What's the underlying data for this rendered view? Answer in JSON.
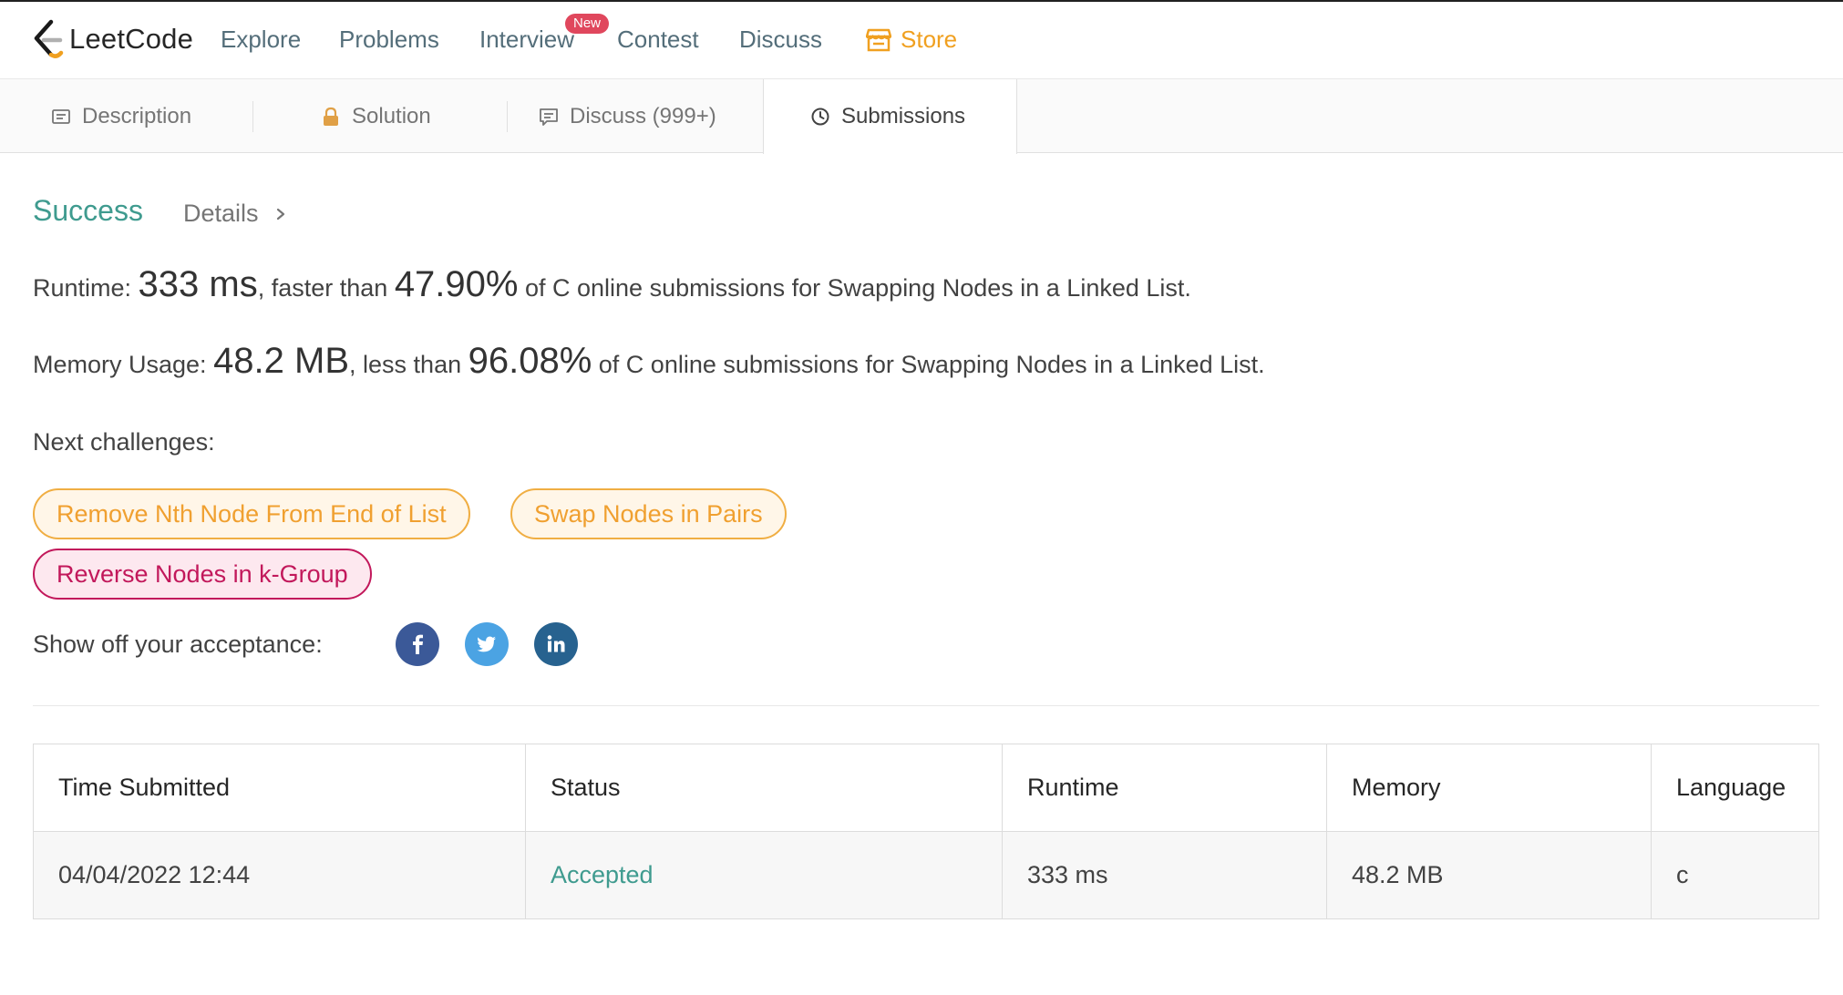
{
  "header": {
    "brand": "LeetCode",
    "nav": [
      {
        "label": "Explore"
      },
      {
        "label": "Problems"
      },
      {
        "label": "Interview",
        "badge": "New"
      },
      {
        "label": "Contest"
      },
      {
        "label": "Discuss"
      }
    ],
    "store_label": "Store",
    "store_color": "#f0a020"
  },
  "tabs": [
    {
      "label": "Description",
      "icon": "description-icon"
    },
    {
      "label": "Solution",
      "icon": "lock-icon"
    },
    {
      "label": "Discuss (999+)",
      "icon": "comment-icon"
    },
    {
      "label": "Submissions",
      "icon": "clock-icon",
      "active": true
    }
  ],
  "result": {
    "status": "Success",
    "status_color": "#3f9b8f",
    "details_label": "Details",
    "runtime": {
      "label": "Runtime: ",
      "value": "333 ms",
      "mid": ", faster than ",
      "percent": "47.90%",
      "tail": " of C online submissions for Swapping Nodes in a Linked List."
    },
    "memory": {
      "label": "Memory Usage: ",
      "value": "48.2 MB",
      "mid": ", less than ",
      "percent": "96.08%",
      "tail": " of C online submissions for Swapping Nodes in a Linked List."
    }
  },
  "next_challenges": {
    "label": "Next challenges:",
    "items": [
      {
        "title": "Remove Nth Node From End of List",
        "difficulty": "medium"
      },
      {
        "title": "Swap Nodes in Pairs",
        "difficulty": "medium"
      },
      {
        "title": "Reverse Nodes in k-Group",
        "difficulty": "hard"
      }
    ]
  },
  "share": {
    "label": "Show off your acceptance:",
    "networks": [
      {
        "icon": "facebook-icon",
        "color": "#3b5998"
      },
      {
        "icon": "twitter-icon",
        "color": "#4ba3e3"
      },
      {
        "icon": "linkedin-icon",
        "color": "#27628f"
      }
    ]
  },
  "submissions": {
    "columns": [
      "Time Submitted",
      "Status",
      "Runtime",
      "Memory",
      "Language"
    ],
    "rows": [
      {
        "time": "04/04/2022 12:44",
        "status": "Accepted",
        "runtime": "333 ms",
        "memory": "48.2 MB",
        "language": "c"
      }
    ]
  }
}
